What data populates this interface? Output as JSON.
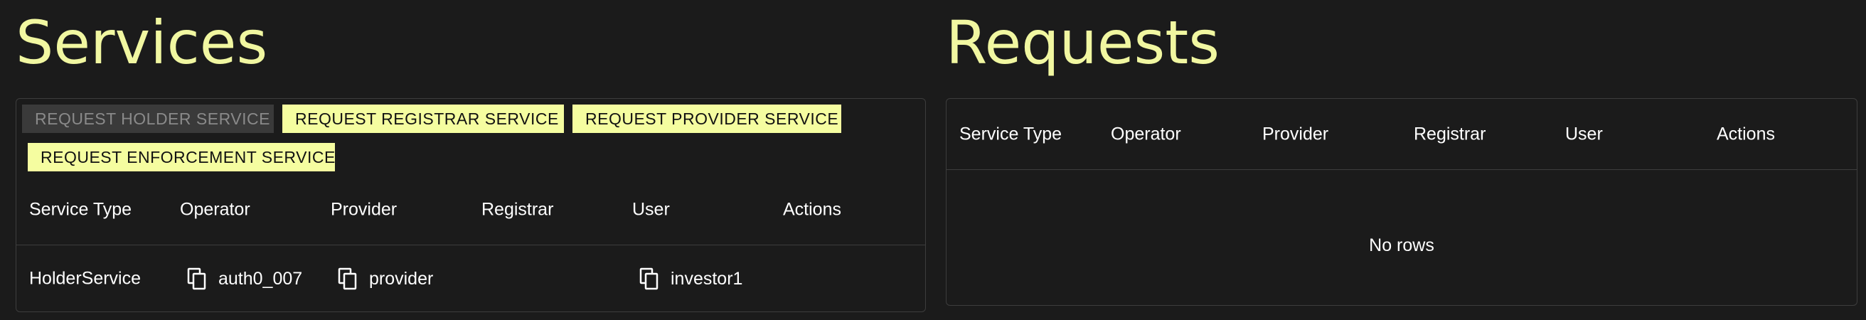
{
  "services": {
    "title": "Services",
    "buttons": [
      {
        "label": "REQUEST HOLDER SERVICE",
        "enabled": false
      },
      {
        "label": "REQUEST REGISTRAR SERVICE",
        "enabled": true
      },
      {
        "label": "REQUEST PROVIDER SERVICE",
        "enabled": true
      },
      {
        "label": "REQUEST ENFORCEMENT SERVICE",
        "enabled": true
      }
    ],
    "columns": [
      "Service Type",
      "Operator",
      "Provider",
      "Registrar",
      "User",
      "Actions"
    ],
    "rows": [
      {
        "service_type": "HolderService",
        "operator": "auth0_007",
        "provider": "provider",
        "registrar": "",
        "user": "investor1",
        "actions": ""
      }
    ]
  },
  "requests": {
    "title": "Requests",
    "columns": [
      "Service Type",
      "Operator",
      "Provider",
      "Registrar",
      "User",
      "Actions"
    ],
    "empty_text": "No rows"
  },
  "colors": {
    "background": "#1b1b1b",
    "accent": "#f5fda0",
    "title": "#f1f7a1",
    "border": "#3d3d3d",
    "disabled_bg": "#3a3a3a",
    "disabled_text": "#8a8a8a"
  },
  "icons": {
    "copy": "copy-icon"
  }
}
